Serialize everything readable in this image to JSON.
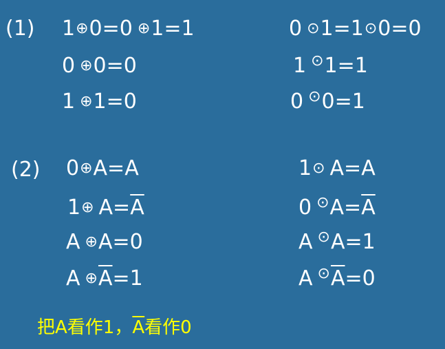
{
  "part1": {
    "label": "(1)",
    "xor": {
      "row1": [
        "1",
        "0=0",
        "1=1"
      ],
      "row2": [
        "0",
        "0=0"
      ],
      "row3": [
        "1",
        "1=0"
      ]
    },
    "xnor": {
      "row1": [
        "0",
        "1=1",
        "0=0"
      ],
      "row2": [
        "1",
        "1=1"
      ],
      "row3": [
        "0",
        "0=1"
      ]
    }
  },
  "part2": {
    "label": "(2)",
    "xor": {
      "row1": [
        "0",
        "A=A"
      ],
      "row2": [
        "1",
        "A=",
        "A"
      ],
      "row3": [
        "A",
        "A=0"
      ],
      "row4": [
        "A",
        "A",
        "=1"
      ]
    },
    "xnor": {
      "row1": [
        "1",
        "A=A"
      ],
      "row2": [
        "0",
        "A=",
        "A"
      ],
      "row3": [
        "A",
        "A=1"
      ],
      "row4": [
        "A",
        "A",
        "=0"
      ]
    }
  },
  "operators": {
    "xor": "⊕",
    "xnor": "⊙"
  },
  "note": {
    "part1": "把A看作1，",
    "bar_letter": "A",
    "part2": "看作0"
  },
  "colors": {
    "background": "#2a6d9c",
    "text": "#ffffff",
    "note": "#ffff00"
  }
}
